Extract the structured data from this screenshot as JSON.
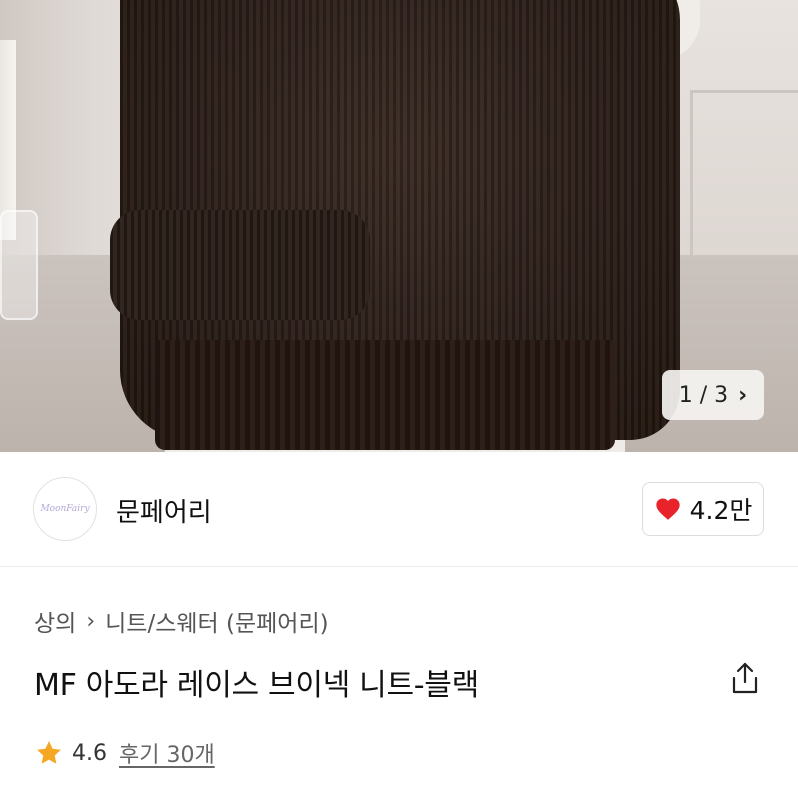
{
  "gallery": {
    "current": "1",
    "separator": "/",
    "total": "3"
  },
  "brand": {
    "name": "문페어리",
    "logo_text": "MoonFairy"
  },
  "like": {
    "count": "4.2만",
    "color": "#e8232a"
  },
  "breadcrumb": {
    "category": "상의",
    "subcategory": "니트/스웨터 (문페어리)"
  },
  "product": {
    "title": "MF 아도라 레이스 브이넥 니트-블랙"
  },
  "rating": {
    "score": "4.6",
    "reviews": "후기 30개",
    "star_color": "#f5a623"
  }
}
